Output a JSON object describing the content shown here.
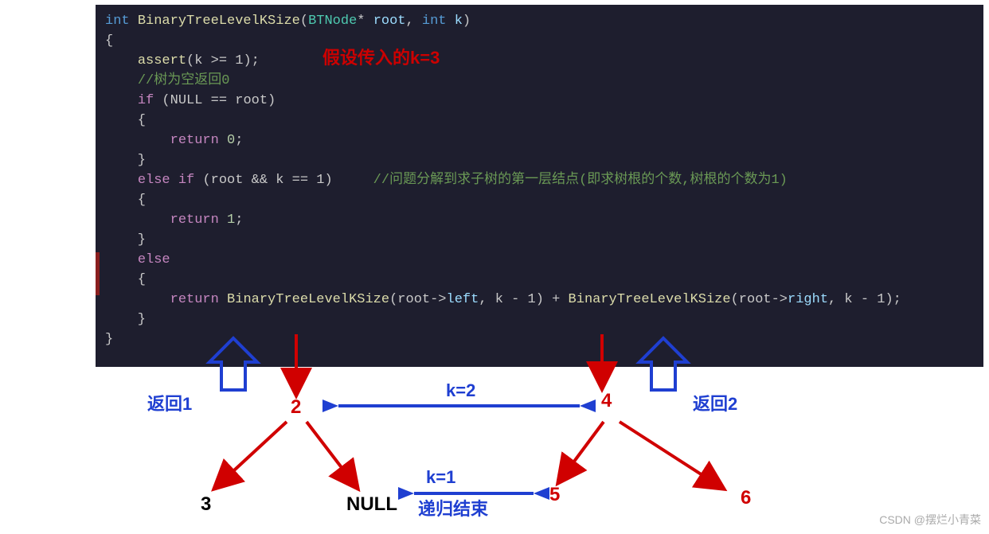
{
  "code": {
    "line1_pre": "int ",
    "line1_fn": "BinaryTreeLevelKSize",
    "line1_p1": "(",
    "line1_type": "BTNode",
    "line1_p2": "* ",
    "line1_root": "root",
    "line1_comma": ", ",
    "line1_int2": "int ",
    "line1_k": "k",
    "line1_p3": ")",
    "line2": "{",
    "line3_indent": "    ",
    "line3_assert": "assert",
    "line3_rest": "(k >= 1);",
    "line4_indent": "    ",
    "line4_comment": "//树为空返回0",
    "line5_indent": "    ",
    "line5_if": "if ",
    "line5_rest": "(NULL == root)",
    "line6": "    {",
    "line7_indent": "        ",
    "line7_return": "return ",
    "line7_val": "0",
    "line7_semi": ";",
    "line8": "    }",
    "line9_indent": "    ",
    "line9_elseif": "else if ",
    "line9_cond": "(root && k == 1)",
    "line9_comment": "     //问题分解到求子树的第一层结点(即求树根的个数,树根的个数为1)",
    "line10": "    {",
    "line11_indent": "        ",
    "line11_return": "return ",
    "line11_val": "1",
    "line11_semi": ";",
    "line12": "    }",
    "line13_indent": "    ",
    "line13_else": "else",
    "line14": "    {",
    "line15_indent": "        ",
    "line15_return": "return ",
    "line15_fn1": "BinaryTreeLevelKSize",
    "line15_p1": "(root->",
    "line15_left": "left",
    "line15_p2": ", k - 1) + ",
    "line15_fn2": "BinaryTreeLevelKSize",
    "line15_p3": "(root->",
    "line15_right": "right",
    "line15_p4": ", k - 1);",
    "line16": "    }",
    "line17": "}"
  },
  "annotations": {
    "assume_k": "假设传入的k=3",
    "return1": "返回1",
    "return2": "返回2",
    "k2": "k=2",
    "k1": "k=1",
    "recursion_end": "递归结束"
  },
  "tree": {
    "n2": "2",
    "n4": "4",
    "n3": "3",
    "nnull": "NULL",
    "n5": "5",
    "n6": "6"
  },
  "watermark": "CSDN @摆烂小青菜"
}
